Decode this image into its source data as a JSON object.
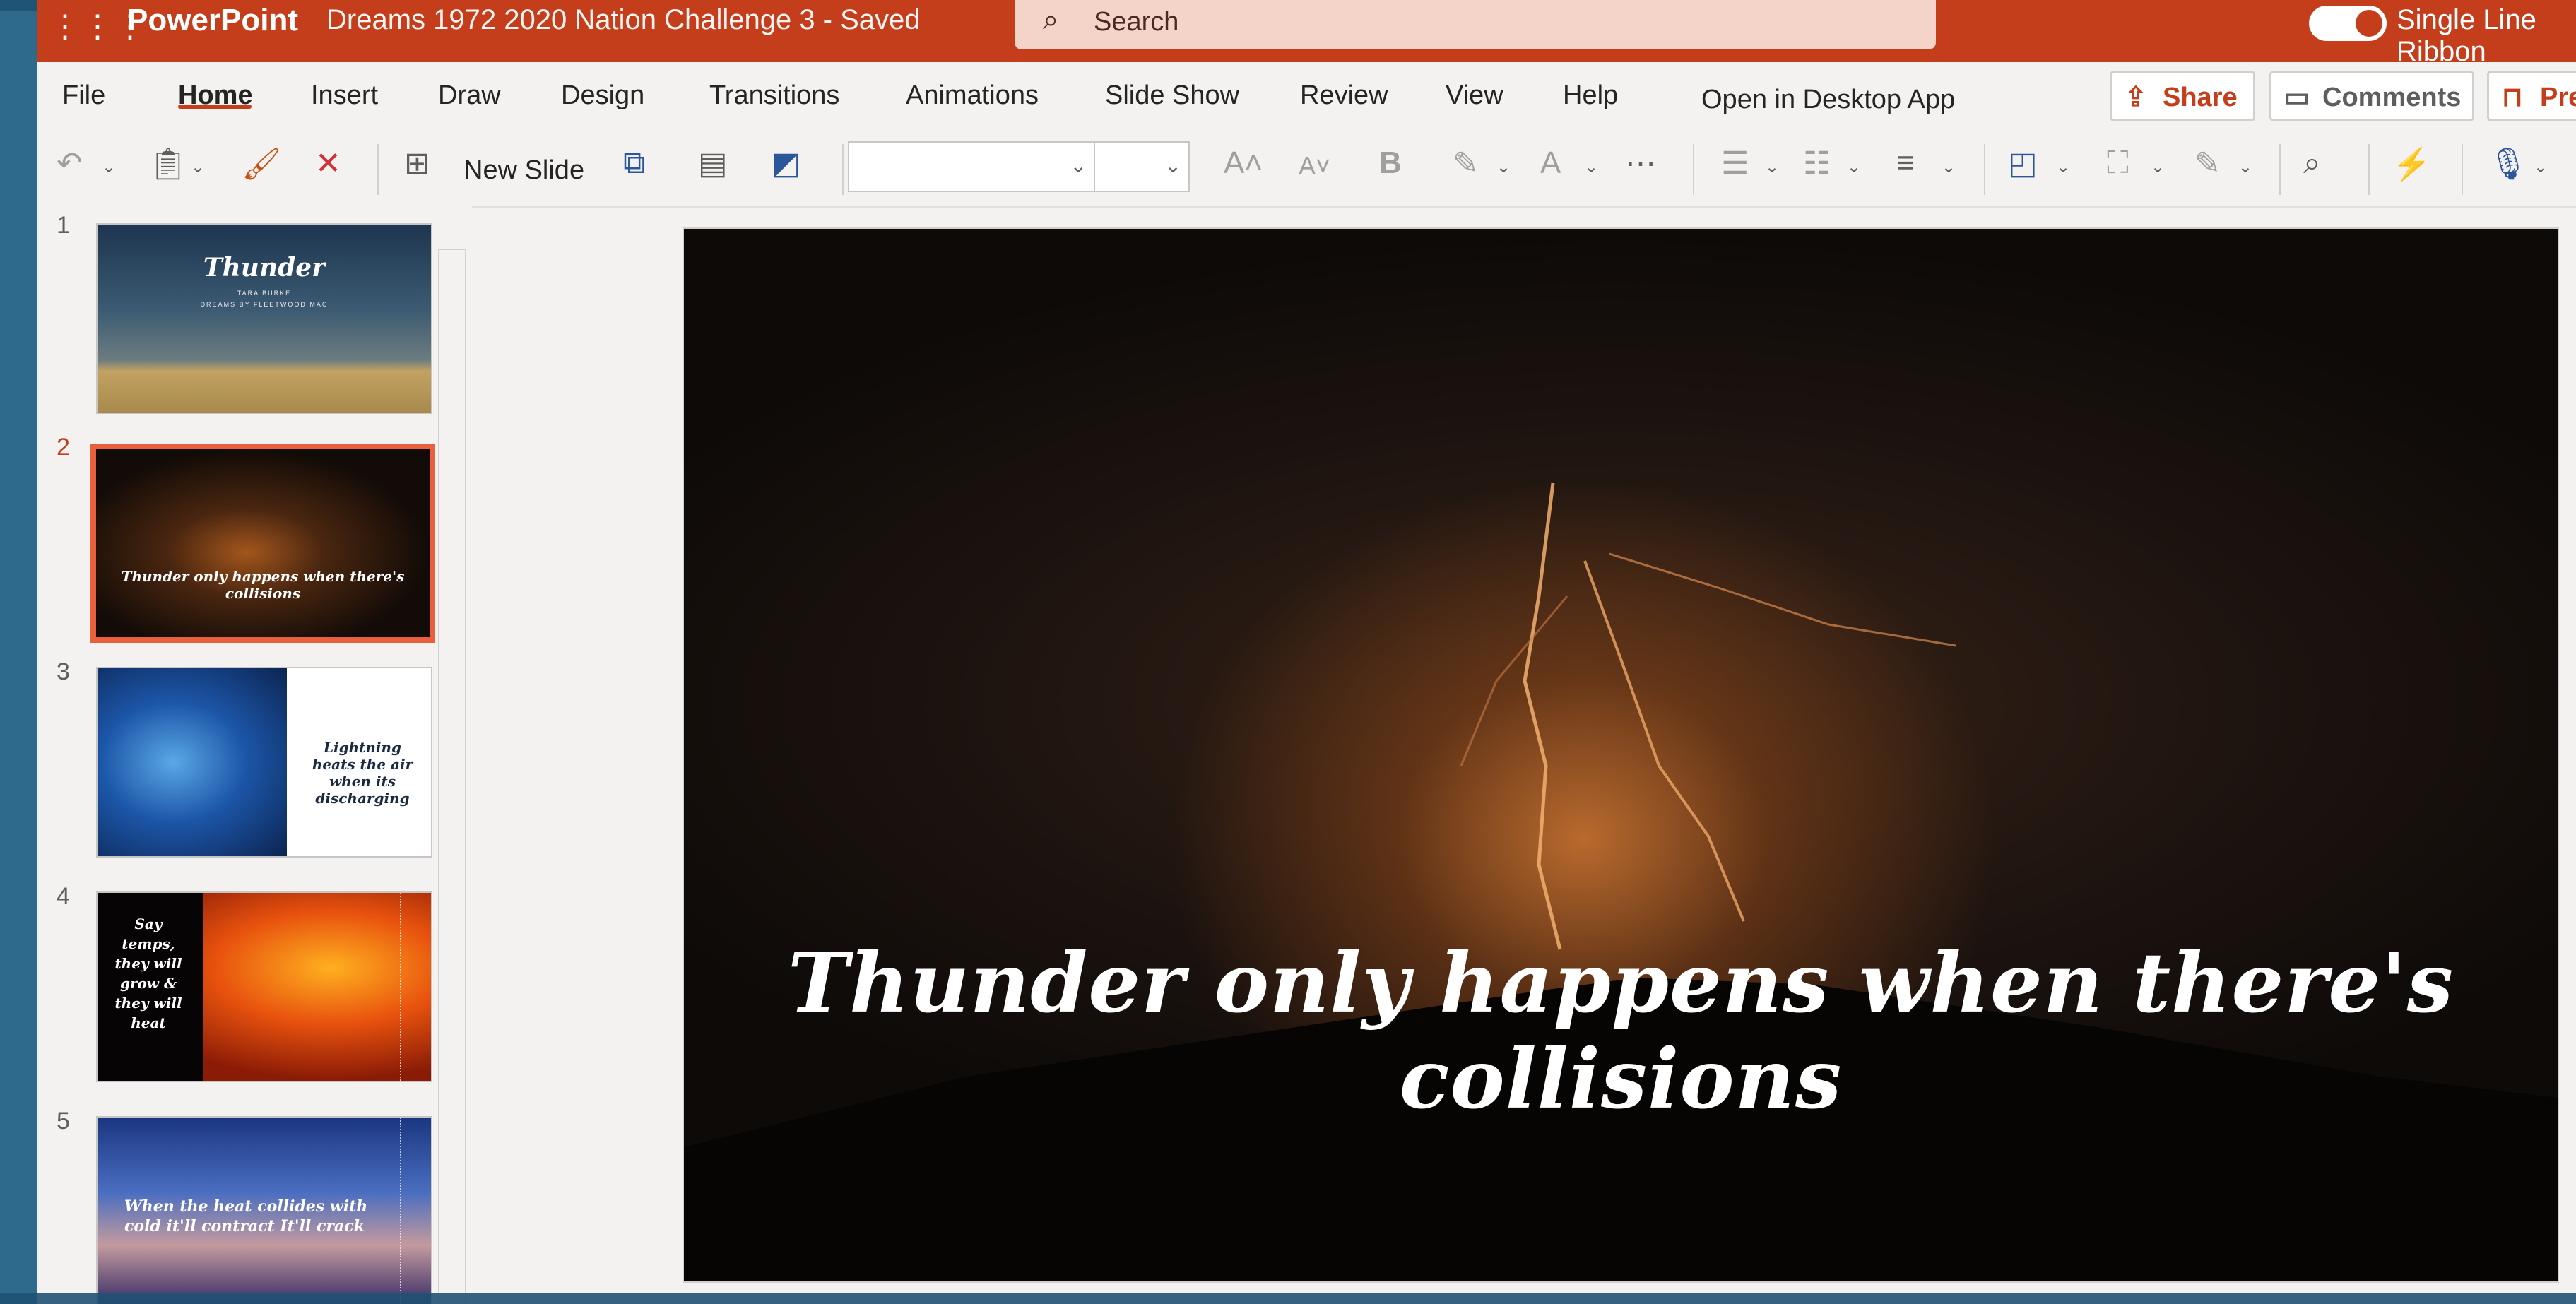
{
  "titlebar": {
    "app_name": "PowerPoint",
    "doc_name": "Dreams 1972 2020 Nation Challenge 3 - Saved",
    "search_placeholder": "Search",
    "line_label": "Single Line Ribbon"
  },
  "menu": {
    "tabs": [
      "File",
      "Home",
      "Insert",
      "Draw",
      "Design",
      "Transitions",
      "Animations",
      "Slide Show",
      "Review",
      "View",
      "Help",
      "Open in Desktop App"
    ],
    "active_tab": "Home",
    "share_label": "Share",
    "comments_label": "Comments",
    "present_label": "Present"
  },
  "ribbon": {
    "new_slide_label": "New Slide",
    "font_name": "",
    "font_size": ""
  },
  "slides": {
    "numbers": [
      "1",
      "2",
      "3",
      "4",
      "5"
    ],
    "selected_index": 2,
    "s1_title": "Thunder",
    "s1_sub": "TARA BURKE",
    "s1_sub2": "DREAMS BY FLEETWOOD MAC",
    "s2_text": "Thunder only happens when there's collisions",
    "s3_text": "Lightning heats the air when its discharging",
    "s4_text": "Say temps, they will grow & they will heat",
    "s5_text": "When the heat collides with cold it'll contract It'll crack"
  },
  "main_slide": {
    "title": "Thunder only happens when there's collisions"
  },
  "colors": {
    "brand": "#c43e1c",
    "selection": "#e8613c"
  },
  "icons": {
    "undo": "undo-icon",
    "paste": "clipboard-icon",
    "format_painter": "paintbrush-icon",
    "delete": "x-icon",
    "search": "magnifier-icon",
    "dictate": "microphone-icon"
  }
}
